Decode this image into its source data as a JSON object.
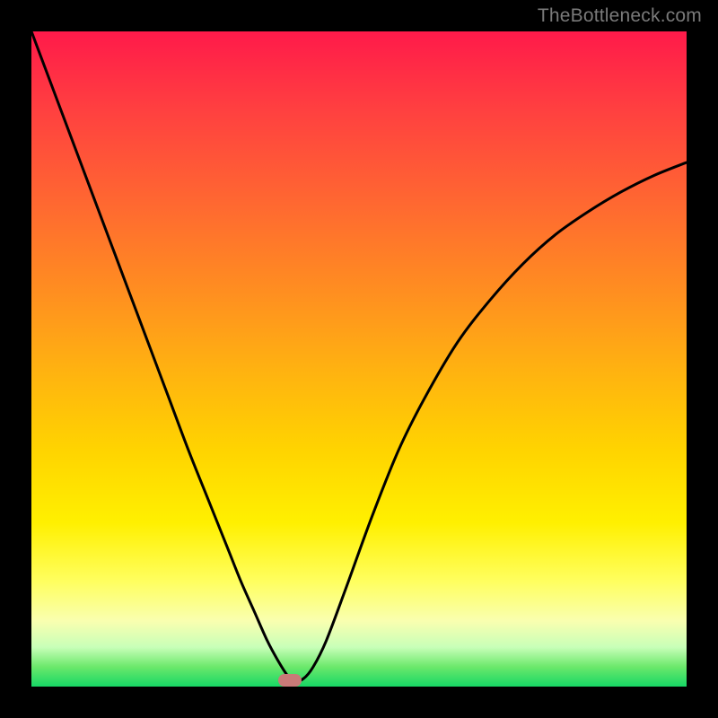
{
  "watermark": "TheBottleneck.com",
  "marker": {
    "cx_frac": 0.395,
    "cy_frac": 0.994
  },
  "chart_data": {
    "type": "line",
    "title": "",
    "xlabel": "",
    "ylabel": "",
    "xlim": [
      0,
      1
    ],
    "ylim": [
      0,
      1
    ],
    "grid": false,
    "legend": false,
    "series": [
      {
        "name": "bottleneck-curve",
        "x": [
          0.0,
          0.03,
          0.06,
          0.09,
          0.12,
          0.15,
          0.18,
          0.21,
          0.24,
          0.27,
          0.3,
          0.32,
          0.34,
          0.36,
          0.375,
          0.39,
          0.4,
          0.415,
          0.43,
          0.45,
          0.48,
          0.52,
          0.56,
          0.6,
          0.65,
          0.7,
          0.75,
          0.8,
          0.85,
          0.9,
          0.95,
          1.0
        ],
        "y": [
          1.0,
          0.92,
          0.84,
          0.76,
          0.68,
          0.6,
          0.52,
          0.44,
          0.36,
          0.285,
          0.21,
          0.16,
          0.115,
          0.07,
          0.042,
          0.018,
          0.008,
          0.012,
          0.03,
          0.07,
          0.15,
          0.26,
          0.36,
          0.44,
          0.525,
          0.59,
          0.645,
          0.69,
          0.725,
          0.755,
          0.78,
          0.8
        ]
      }
    ],
    "annotations": [
      {
        "type": "marker",
        "shape": "rounded-rect",
        "x": 0.395,
        "y": 0.006,
        "color": "#c97a78"
      }
    ]
  }
}
